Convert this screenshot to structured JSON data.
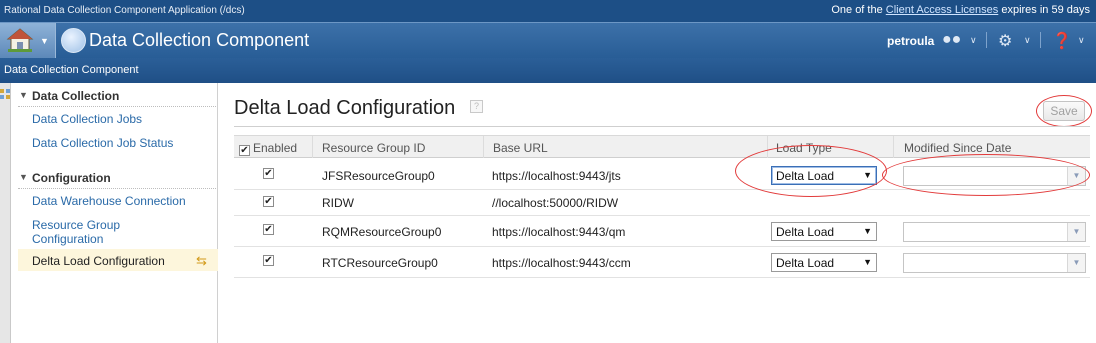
{
  "topbar": {
    "app_title": "Rational Data Collection Component Application (/dcs)",
    "license_prefix": "One of the ",
    "license_link": "Client Access Licenses",
    "license_suffix": " expires in 59 days"
  },
  "banner": {
    "app_name": "Data Collection Component",
    "user": "petroula",
    "icons": [
      "home-icon",
      "app-icon",
      "users-icon",
      "gear-icon",
      "help-icon"
    ]
  },
  "breadcrumb": {
    "label": "Data Collection Component"
  },
  "sidebar": {
    "sections": [
      {
        "title": "Data Collection",
        "items": [
          "Data Collection Jobs",
          "Data Collection Job Status"
        ]
      },
      {
        "title": "Configuration",
        "items": [
          "Data Warehouse Connection",
          "Resource Group Configuration",
          "Delta Load Configuration"
        ]
      }
    ],
    "resource_group_line1": "Resource Group",
    "resource_group_line2": "Configuration",
    "active_item": "Delta Load Configuration"
  },
  "page": {
    "title": "Delta Load Configuration",
    "save_label": "Save"
  },
  "table": {
    "columns": [
      "Enabled",
      "Resource Group ID",
      "Base URL",
      "Load Type",
      "Modified Since Date"
    ],
    "rows": [
      {
        "enabled": true,
        "id": "JFSResourceGroup0",
        "url": "https://localhost:9443/jts",
        "load_type": "Delta Load",
        "modified_since": ""
      },
      {
        "enabled": true,
        "id": "RIDW",
        "url": "//localhost:50000/RIDW",
        "load_type": null,
        "modified_since": null
      },
      {
        "enabled": true,
        "id": "RQMResourceGroup0",
        "url": "https://localhost:9443/qm",
        "load_type": "Delta Load",
        "modified_since": ""
      },
      {
        "enabled": true,
        "id": "RTCResourceGroup0",
        "url": "https://localhost:9443/ccm",
        "load_type": "Delta Load",
        "modified_since": ""
      }
    ]
  },
  "colors": {
    "header_blue": "#285d96",
    "link_blue": "#2a6aa8",
    "annotation_red": "#e23b3b",
    "active_row": "#fdf6dc"
  }
}
